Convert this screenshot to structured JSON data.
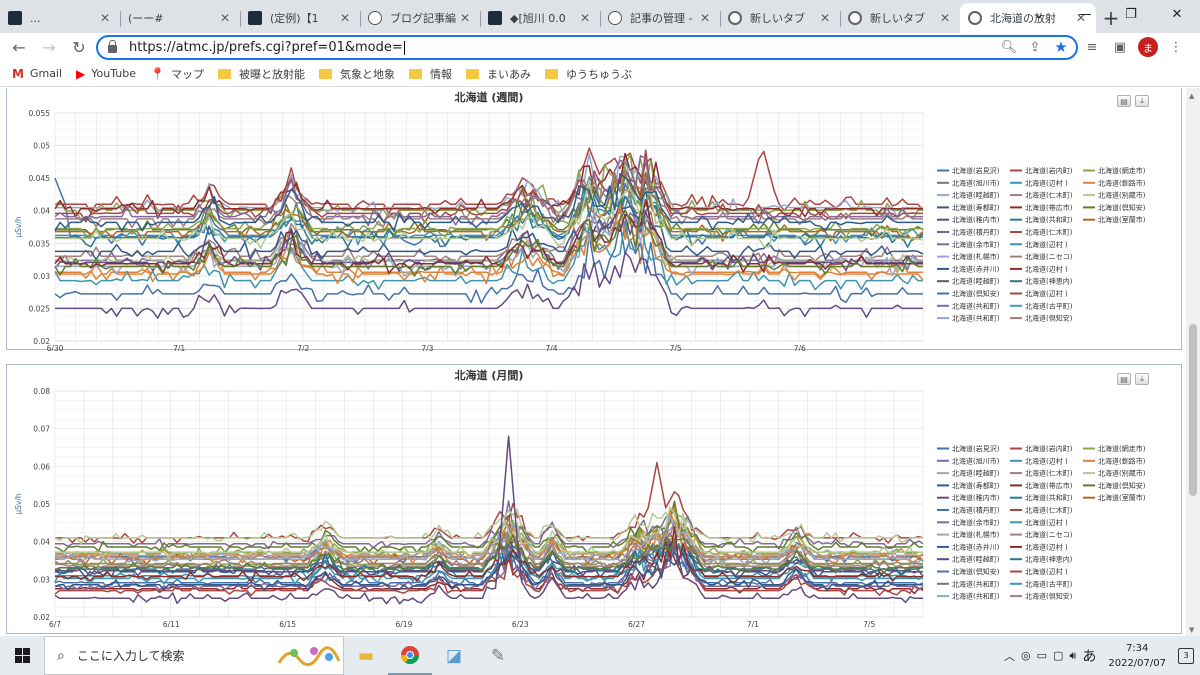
{
  "browser": {
    "tabs": [
      {
        "title": "...",
        "favicon": "dark"
      },
      {
        "title": "(ーー#",
        "favicon": "none"
      },
      {
        "title": "(定例)【1",
        "favicon": "dark"
      },
      {
        "title": "ブログ記事編",
        "favicon": "bulb"
      },
      {
        "title": "◆[旭川 0.0",
        "favicon": "dark"
      },
      {
        "title": "記事の管理 -",
        "favicon": "bulb"
      },
      {
        "title": "新しいタブ",
        "favicon": "globe"
      },
      {
        "title": "新しいタブ",
        "favicon": "globe"
      },
      {
        "title": "北海道の放射",
        "favicon": "globe",
        "active": true
      }
    ],
    "url": "https://atmc.jp/prefs.cgi?pref=01&mode=",
    "avatar_letter": "ま",
    "bookmarks": [
      {
        "label": "Gmail",
        "icon": "M"
      },
      {
        "label": "YouTube",
        "icon": "▶"
      },
      {
        "label": "マップ",
        "icon": "📍"
      },
      {
        "label": "被曝と放射能",
        "icon": "folder"
      },
      {
        "label": "気象と地象",
        "icon": "folder"
      },
      {
        "label": "情報",
        "icon": "folder"
      },
      {
        "label": "まいあみ",
        "icon": "folder"
      },
      {
        "label": "ゆうちゅうぶ",
        "icon": "folder"
      }
    ]
  },
  "legend": [
    [
      "北海道(岩見沢)",
      "北海道(岩内町)",
      "北海道(網走市)"
    ],
    [
      "北海道(旭川市)",
      "北海道(辺村 )",
      "北海道(釧路市)"
    ],
    [
      "北海道(睦越町)",
      "北海道(仁木町)",
      "北海道(別蔵市)"
    ],
    [
      "北海道(寿都町)",
      "北海道(帯広市)",
      "北海道(倶知安)"
    ],
    [
      "北海道(稚内市)",
      "北海道(共和町)",
      "北海道(室蘭市)"
    ],
    [
      "北海道(積丹町)",
      "北海道(仁木町)"
    ],
    [
      "北海道(余市町)",
      "北海道(辺村 )"
    ],
    [
      "北海道(札幌市)",
      "北海道(ニセコ)"
    ],
    [
      "北海道(赤井川)",
      "北海道(辺村 )"
    ],
    [
      "北海道(睦越町)",
      "北海道(神恵内)"
    ],
    [
      "北海道(倶知安)",
      "北海道(辺村 )"
    ],
    [
      "北海道(共和町)",
      "北海道(古平町)"
    ],
    [
      "北海道(共和町)",
      "北海道(倶知安)"
    ]
  ],
  "legend_colors": [
    "#4572a7",
    "#aa4643",
    "#89a54e",
    "#80699b",
    "#3d96ae",
    "#db843d",
    "#92a8cd",
    "#a47d7c",
    "#b5ca92",
    "#2f5a8a",
    "#8b2c2a",
    "#5e7d2c",
    "#634a80",
    "#2a7a8f",
    "#b8661f"
  ],
  "chart_data": [
    {
      "type": "line",
      "title": "北海道 (週間)",
      "ylabel": "μSv/h",
      "ylim": [
        0.02,
        0.055
      ],
      "yticks": [
        "0.055",
        "0.05",
        "0.045",
        "0.04",
        "0.035",
        "0.03",
        "0.025",
        "0.02"
      ],
      "xticks": [
        "6/30",
        "7/1",
        "7/2",
        "7/3",
        "7/4",
        "7/5",
        "7/6"
      ],
      "series_count": 28,
      "series_values": {
        "北海道(岩見沢)": [
          0.045,
          0.041,
          0.038,
          0.036,
          0.037,
          0.036,
          0.038,
          0.037,
          0.036,
          0.037,
          0.036,
          0.035,
          0.036,
          0.037
        ],
        "北海道(旭川市)": [
          0.04,
          0.041,
          0.041,
          0.04,
          0.041,
          0.041,
          0.041,
          0.04,
          0.041,
          0.041,
          0.05,
          0.041,
          0.041,
          0.041
        ],
        "北海道(共和町)": [
          0.025,
          0.025,
          0.025,
          0.025,
          0.025,
          0.025,
          0.025,
          0.025,
          0.025,
          0.025,
          0.025,
          0.025,
          0.025,
          0.025
        ]
      }
    },
    {
      "type": "line",
      "title": "北海道 (月間)",
      "ylabel": "μSv/h",
      "ylim": [
        0.02,
        0.08
      ],
      "yticks": [
        "0.08",
        "0.07",
        "0.06",
        "0.05",
        "0.04",
        "0.03",
        "0.02"
      ],
      "xticks": [
        "6/7",
        "6/11",
        "6/15",
        "6/19",
        "6/23",
        "6/27",
        "7/1",
        "7/5"
      ],
      "series_count": 28,
      "series_values": {
        "北海道(旭川市)": [
          0.041,
          0.041,
          0.045,
          0.041,
          0.041,
          0.041,
          0.049,
          0.041,
          0.041,
          0.045,
          0.041,
          0.062,
          0.041,
          0.041,
          0.041,
          0.041
        ],
        "北海道(共和町)": [
          0.025,
          0.025,
          0.025,
          0.025,
          0.025,
          0.025,
          0.025,
          0.025,
          0.068,
          0.025,
          0.025,
          0.055,
          0.025,
          0.025,
          0.025,
          0.025
        ]
      }
    }
  ],
  "taskbar": {
    "search_placeholder": "ここに入力して検索",
    "time": "7:34",
    "date": "2022/07/07",
    "ime": "あ",
    "notification_count": "3"
  }
}
